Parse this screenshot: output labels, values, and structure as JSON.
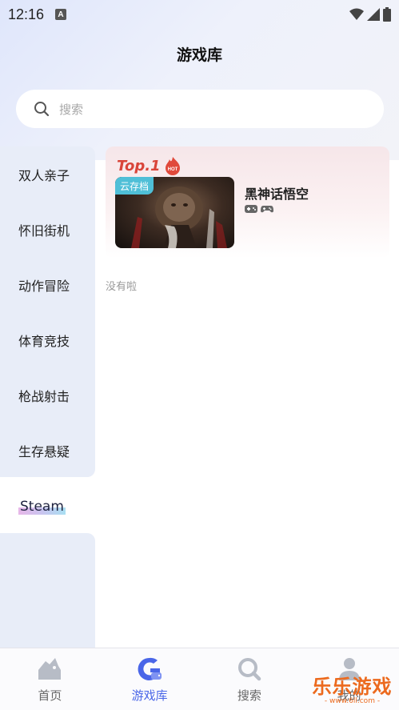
{
  "status_bar": {
    "time": "12:16",
    "notif_icon": "A"
  },
  "header": {
    "title": "游戏库"
  },
  "search": {
    "placeholder": "搜索"
  },
  "sidebar": {
    "items": [
      {
        "label": "双人亲子"
      },
      {
        "label": "怀旧街机"
      },
      {
        "label": "动作冒险"
      },
      {
        "label": "体育竞技"
      },
      {
        "label": "枪战射击"
      },
      {
        "label": "生存悬疑"
      },
      {
        "label": "Steam",
        "active": true
      }
    ]
  },
  "featured": {
    "rank": "Top.1",
    "badge": "HOT",
    "tag": "云存档",
    "title": "黑神话悟空",
    "platform_icons": [
      "controller-icon",
      "gamepad-icon"
    ]
  },
  "empty_message": "没有啦",
  "bottom_nav": {
    "items": [
      {
        "label": "首页",
        "icon": "home-icon"
      },
      {
        "label": "游戏库",
        "icon": "game-library-icon",
        "active": true
      },
      {
        "label": "搜索",
        "icon": "search-icon"
      },
      {
        "label": "我的",
        "icon": "profile-icon"
      }
    ]
  },
  "watermark": {
    "title": "乐乐游戏",
    "url": "- www.6ll.com -"
  },
  "colors": {
    "accent": "#4a66e8",
    "hot": "#d9453a",
    "cloud_tag": "#4fbfd7"
  }
}
